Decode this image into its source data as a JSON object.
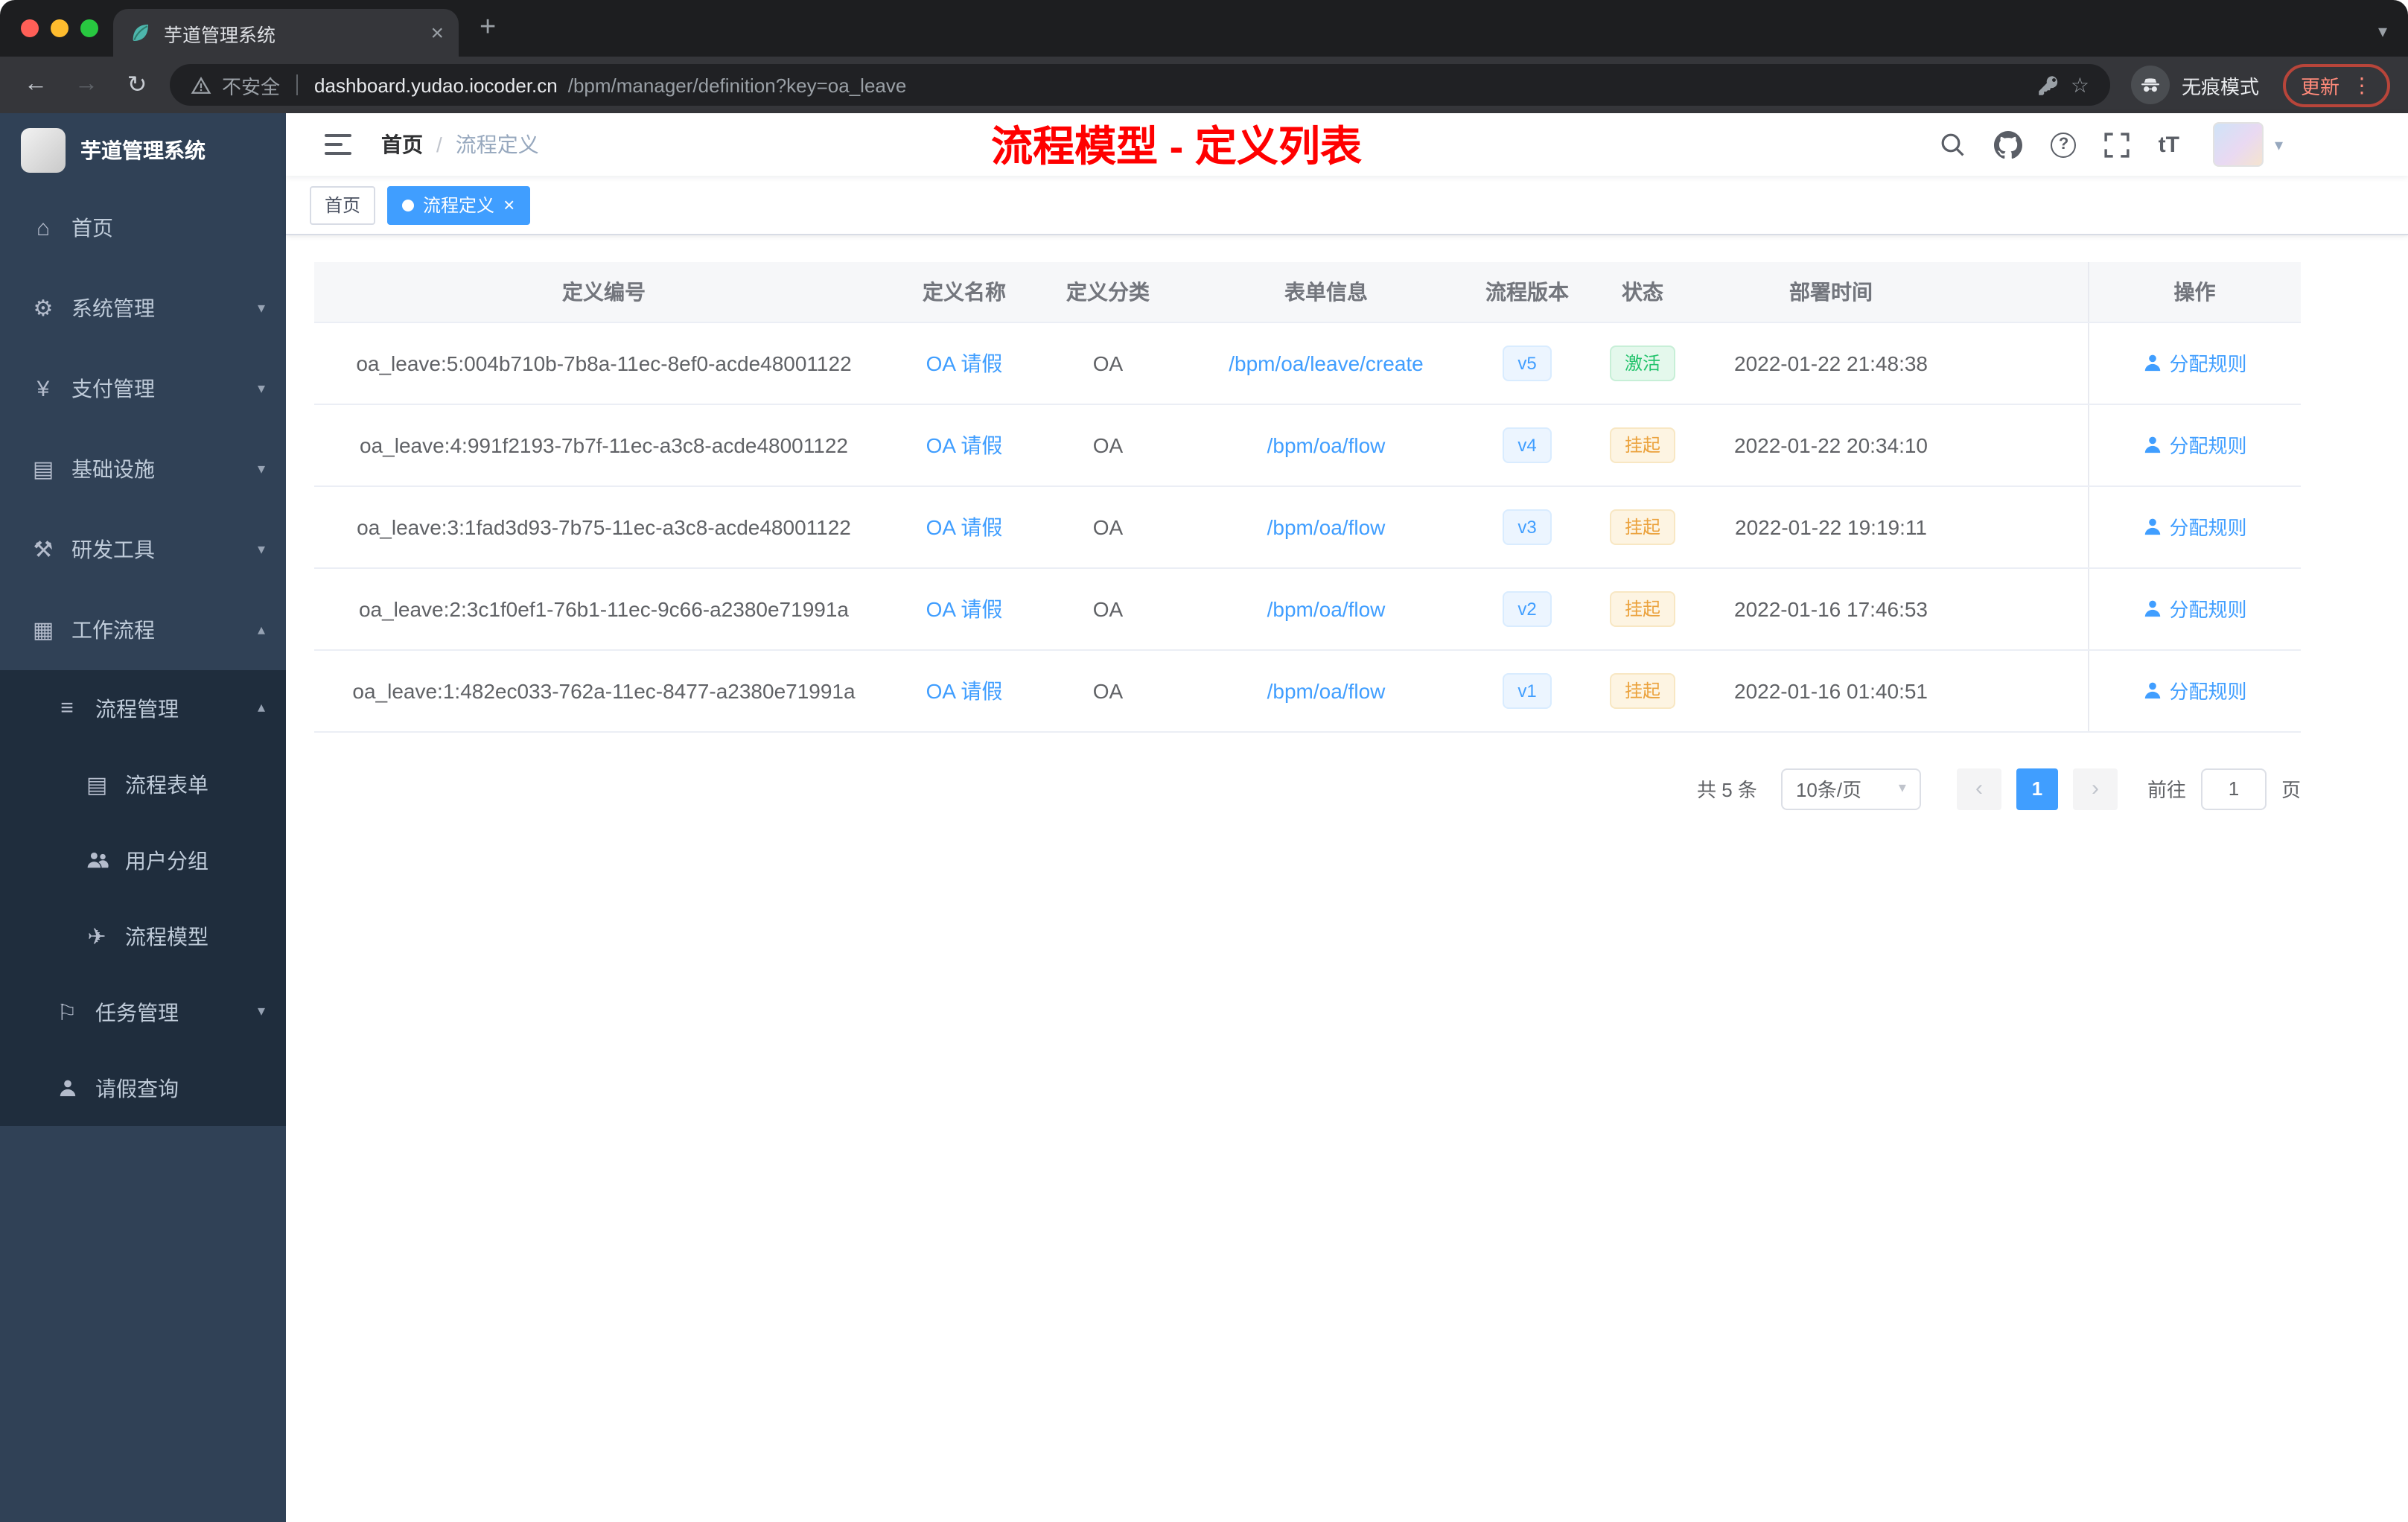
{
  "browser": {
    "tab_title": "芋道管理系统",
    "security_label": "不安全",
    "url_domain": "dashboard.yudao.iocoder.cn",
    "url_path": "/bpm/manager/definition?key=oa_leave",
    "incognito_label": "无痕模式",
    "update_label": "更新"
  },
  "icons": {
    "back": "←",
    "forward": "→",
    "reload": "↻",
    "close": "×",
    "plus": "+",
    "menu_dots": "⋮",
    "star": "☆",
    "caret_down": "▾",
    "chevron_down": "▾",
    "chevron_up": "▴",
    "pager_prev": "‹",
    "pager_next": "›",
    "breadcrumb_sep": "/",
    "font_size": "tT",
    "question": "?",
    "home": "⌂",
    "system": "⚙",
    "payment": "¥",
    "infrastructure": "▤",
    "devtools": "⚒",
    "workflow": "▦",
    "process_manage": "≡",
    "process_form": "▤",
    "process_model": "✈",
    "task_manage": "⚐"
  },
  "sidebar": {
    "logo_title": "芋道管理系统",
    "items": {
      "home": "首页",
      "system": "系统管理",
      "payment": "支付管理",
      "infrastructure": "基础设施",
      "devtools": "研发工具",
      "workflow": "工作流程",
      "process_manage": "流程管理",
      "process_form": "流程表单",
      "user_group": "用户分组",
      "process_model": "流程模型",
      "task_manage": "任务管理",
      "leave_query": "请假查询"
    }
  },
  "header": {
    "breadcrumb_home": "首页",
    "breadcrumb_current": "流程定义",
    "annotation": "流程模型 - 定义列表"
  },
  "tags": {
    "home": "首页",
    "current": "流程定义"
  },
  "table": {
    "columns": {
      "id": "定义编号",
      "name": "定义名称",
      "category": "定义分类",
      "form": "表单信息",
      "version": "流程版本",
      "status": "状态",
      "deployed": "部署时间",
      "action": "操作"
    },
    "rows": [
      {
        "id": "oa_leave:5:004b710b-7b8a-11ec-8ef0-acde48001122",
        "name": "OA 请假",
        "category": "OA",
        "form": "/bpm/oa/leave/create",
        "version": "v5",
        "status": "激活",
        "status_type": "success",
        "deployed": "2022-01-22 21:48:38",
        "action": "分配规则"
      },
      {
        "id": "oa_leave:4:991f2193-7b7f-11ec-a3c8-acde48001122",
        "name": "OA 请假",
        "category": "OA",
        "form": "/bpm/oa/flow",
        "version": "v4",
        "status": "挂起",
        "status_type": "warning",
        "deployed": "2022-01-22 20:34:10",
        "action": "分配规则"
      },
      {
        "id": "oa_leave:3:1fad3d93-7b75-11ec-a3c8-acde48001122",
        "name": "OA 请假",
        "category": "OA",
        "form": "/bpm/oa/flow",
        "version": "v3",
        "status": "挂起",
        "status_type": "warning",
        "deployed": "2022-01-22 19:19:11",
        "action": "分配规则"
      },
      {
        "id": "oa_leave:2:3c1f0ef1-76b1-11ec-9c66-a2380e71991a",
        "name": "OA 请假",
        "category": "OA",
        "form": "/bpm/oa/flow",
        "version": "v2",
        "status": "挂起",
        "status_type": "warning",
        "deployed": "2022-01-16 17:46:53",
        "action": "分配规则"
      },
      {
        "id": "oa_leave:1:482ec033-762a-11ec-8477-a2380e71991a",
        "name": "OA 请假",
        "category": "OA",
        "form": "/bpm/oa/flow",
        "version": "v1",
        "status": "挂起",
        "status_type": "warning",
        "deployed": "2022-01-16 01:40:51",
        "action": "分配规则"
      }
    ]
  },
  "pagination": {
    "total": "共 5 条",
    "page_size": "10条/页",
    "current_page": "1",
    "goto_label": "前往",
    "goto_value": "1",
    "page_unit": "页"
  }
}
